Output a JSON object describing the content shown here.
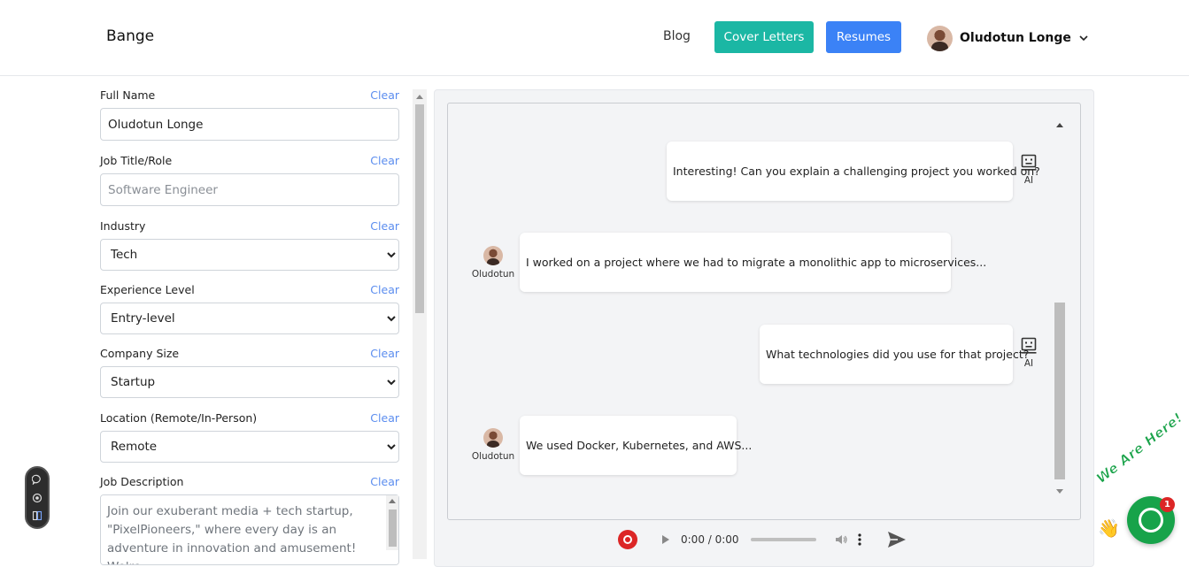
{
  "header": {
    "brand": "Bange",
    "nav": {
      "blog": "Blog",
      "cover_letters": "Cover Letters",
      "resumes": "Resumes"
    },
    "user_name": "Oludotun Longe",
    "colors": {
      "cover_letters": "#1bb7a4",
      "resumes": "#3b82f6"
    }
  },
  "form": {
    "clear_label": "Clear",
    "full_name": {
      "label": "Full Name",
      "value": "Oludotun Longe"
    },
    "job_title": {
      "label": "Job Title/Role",
      "placeholder": "Software Engineer"
    },
    "industry": {
      "label": "Industry",
      "selected": "Tech"
    },
    "experience": {
      "label": "Experience Level",
      "selected": "Entry-level"
    },
    "company_size": {
      "label": "Company Size",
      "selected": "Startup"
    },
    "location": {
      "label": "Location (Remote/In-Person)",
      "selected": "Remote"
    },
    "job_description": {
      "label": "Job Description",
      "value": "Join our exuberant media + tech startup, \"PixelPioneers,\" where every day is an adventure in innovation and amusement! We're"
    }
  },
  "chat": {
    "messages": [
      {
        "sender": "AI",
        "text": "Interesting! Can you explain a challenging project you worked on?"
      },
      {
        "sender": "Oludotun",
        "text": "I worked on a project where we had to migrate a monolithic app to microservices..."
      },
      {
        "sender": "AI",
        "text": "What technologies did you use for that project?"
      },
      {
        "sender": "Oludotun",
        "text": "We used Docker, Kubernetes, and AWS..."
      }
    ]
  },
  "audio": {
    "time": "0:00 / 0:00"
  },
  "widgets": {
    "help_text": "We Are Here!",
    "notification_count": "1"
  }
}
